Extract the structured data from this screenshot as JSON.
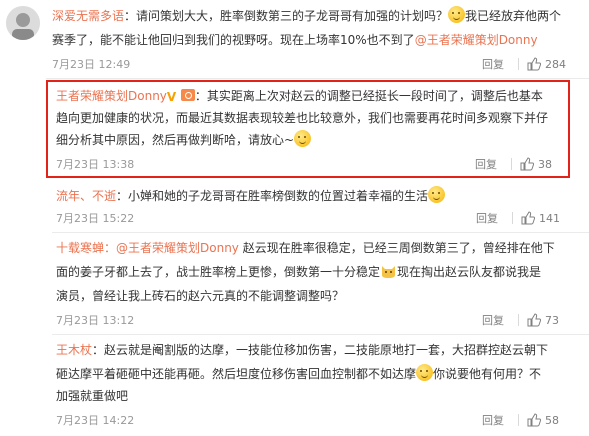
{
  "comments": [
    {
      "user": "深爱无需多语",
      "text_line1": "：请问策划大大，胜率倒数第三的子龙哥哥有加强的计划吗？",
      "text_line1_after": "我已经放弃他两个",
      "text_line2": "赛季了，能不能让他回归到我们的视野呀。现在上场率10%也不到了",
      "mention": "@王者荣耀策划Donny",
      "time": "7月23日 12:49",
      "reply": "回复",
      "likes": "284"
    },
    {
      "user": "王者荣耀策划Donny",
      "text_line1": "：其实距离上次对赵云的调整已经挺长一段时间了，调整后也基本",
      "text_line2": "趋向更加健康的状况，而最近其数据表现较差也比较意外，我们也需要再花时间多观察下并仔",
      "text_line3": "细分析其中原因，然后再做判断哈，请放心~",
      "time": "7月23日 13:38",
      "reply": "回复",
      "likes": "38"
    },
    {
      "user": "流年、不逝",
      "text_line1": "：小婵和她的子龙哥哥在胜率榜倒数的位置过着幸福的生活",
      "time": "7月23日 15:22",
      "reply": "回复",
      "likes": "141"
    },
    {
      "user": "十载寒蝉",
      "mention": "：@王者荣耀策划Donny",
      "text_line1": " 赵云现在胜率很稳定，已经三周倒数第三了，曾经排在他下",
      "text_line2": "面的姜子牙都上去了，战士胜率榜上更惨，倒数第一十分稳定",
      "text_line2_after": "现在掏出赵云队友都说我是",
      "text_line3": "演员，曾经让我上砖石的赵六元真的不能调整调整吗？",
      "time": "7月23日 13:12",
      "reply": "回复",
      "likes": "73"
    },
    {
      "user": "王木杖",
      "text_line1": "：赵云就是阉割版的达摩，一技能位移加伤害，二技能原地打一套，大招群控赵云朝下",
      "text_line2": "砸达摩平着砸砸中还能再砸。然后坦度位移伤害回血控制都不如达摩",
      "text_line2_after": "你说要他有何用？不",
      "text_line3": "加强就重做吧",
      "time": "7月23日 14:22",
      "reply": "回复",
      "likes": "58"
    }
  ]
}
